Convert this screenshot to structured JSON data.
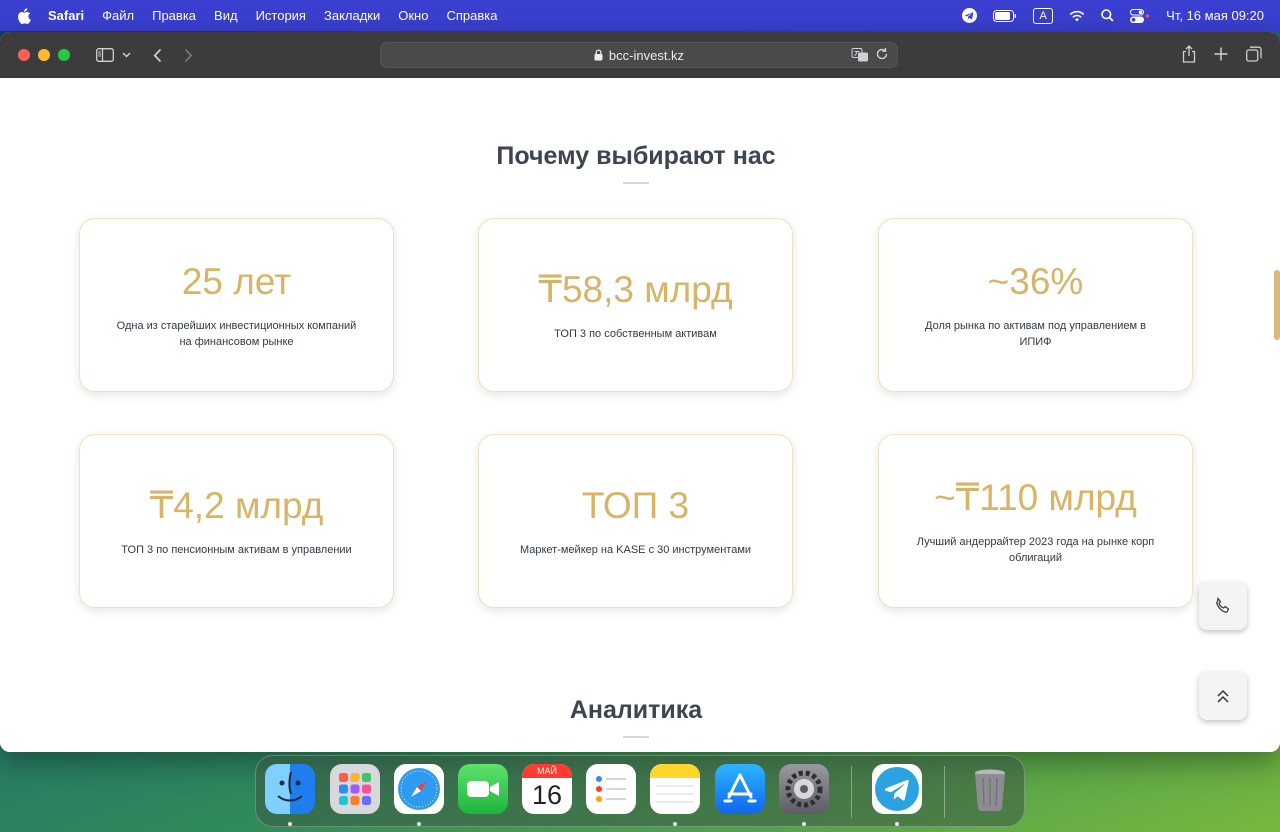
{
  "menubar": {
    "app_name": "Safari",
    "items": [
      "Файл",
      "Правка",
      "Вид",
      "История",
      "Закладки",
      "Окно",
      "Справка"
    ],
    "keyboard_layout": "A",
    "clock": "Чт, 16 мая  09:20"
  },
  "browser": {
    "url": "bcc-invest.kz"
  },
  "page": {
    "why_title": "Почему выбирают нас",
    "cards": [
      {
        "value": "25 лет",
        "desc": "Одна из старейших инвестиционных компаний на финансовом рынке"
      },
      {
        "value": "₸58,3 млрд",
        "desc": "ТОП 3 по собственным активам"
      },
      {
        "value": "~36%",
        "desc": "Доля рынка по активам под управлением в ИПИФ"
      },
      {
        "value": "₸4,2 млрд",
        "desc": "ТОП 3 по пенсионным активам в управлении"
      },
      {
        "value": "ТОП 3",
        "desc": "Маркет-мейкер на KASE с 30 инструментами"
      },
      {
        "value": "~₸110 млрд",
        "desc": "Лучший андеррайтер 2023 года на рынке корп облигаций"
      }
    ],
    "analytics_title": "Аналитика"
  },
  "dock": {
    "calendar_month": "МАЙ",
    "calendar_day": "16",
    "apps": [
      "finder",
      "launchpad",
      "safari",
      "facetime",
      "calendar",
      "reminders",
      "notes",
      "app-store",
      "system-settings",
      "telegram",
      "trash"
    ]
  },
  "colors": {
    "accent_gold": "#d7b466",
    "menubar_bg": "#3a3fcf",
    "toolbar_bg": "#3c3c3e"
  }
}
